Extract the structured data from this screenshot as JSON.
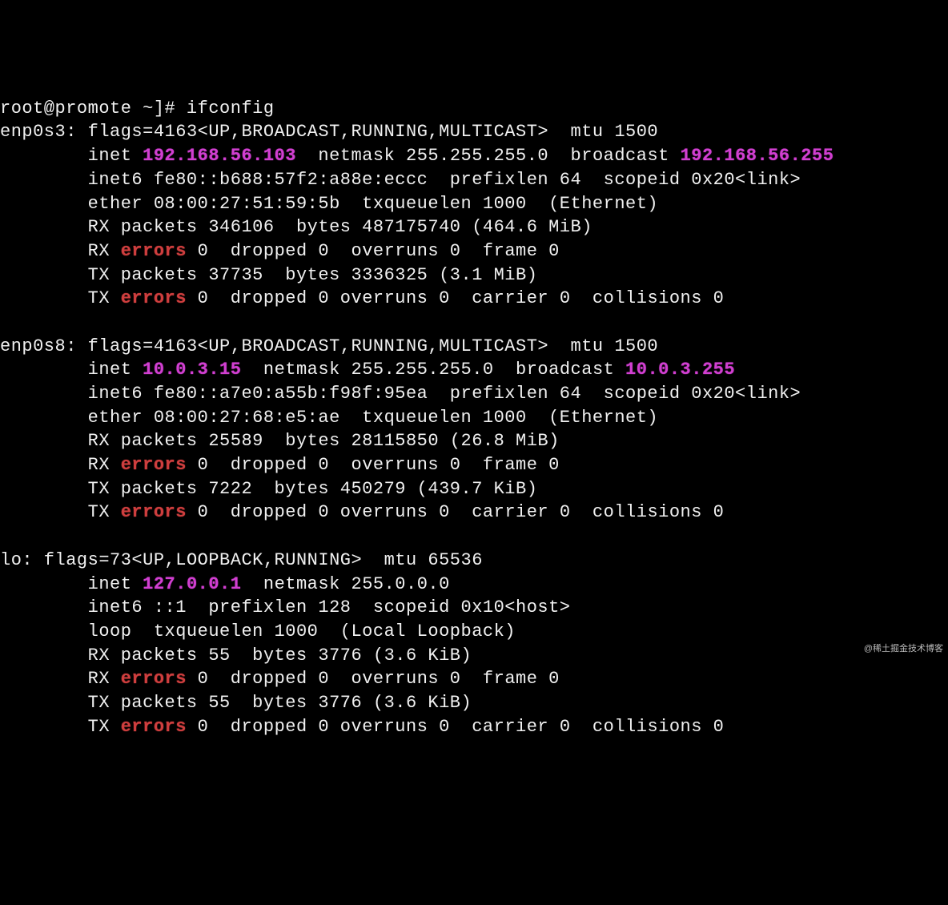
{
  "prompt": "root@promote ~]# ifconfig",
  "interfaces": {
    "enp0s3": {
      "name": "enp0s3:",
      "flags_line": " flags=4163<UP,BROADCAST,RUNNING,MULTICAST>  mtu 1500",
      "inet_prefix": "        inet ",
      "inet_addr": "192.168.56.103",
      "inet_rest": "  netmask 255.255.255.0  broadcast ",
      "broadcast": "192.168.56.255",
      "inet6": "        inet6 fe80::b688:57f2:a88e:eccc  prefixlen 64  scopeid 0x20<link>",
      "ether": "        ether 08:00:27:51:59:5b  txqueuelen 1000  (Ethernet)",
      "rx_pkts": "        RX packets 346106  bytes 487175740 (464.6 MiB)",
      "rx_err_pre": "        RX ",
      "rx_err_word": "errors",
      "rx_err_rest": " 0  dropped 0  overruns 0  frame 0",
      "tx_pkts": "        TX packets 37735  bytes 3336325 (3.1 MiB)",
      "tx_err_pre": "        TX ",
      "tx_err_word": "errors",
      "tx_err_rest": " 0  dropped 0 overruns 0  carrier 0  collisions 0"
    },
    "enp0s8": {
      "name": "enp0s8:",
      "flags_line": " flags=4163<UP,BROADCAST,RUNNING,MULTICAST>  mtu 1500",
      "inet_prefix": "        inet ",
      "inet_addr": "10.0.3.15",
      "inet_rest": "  netmask 255.255.255.0  broadcast ",
      "broadcast": "10.0.3.255",
      "inet6": "        inet6 fe80::a7e0:a55b:f98f:95ea  prefixlen 64  scopeid 0x20<link>",
      "ether": "        ether 08:00:27:68:e5:ae  txqueuelen 1000  (Ethernet)",
      "rx_pkts": "        RX packets 25589  bytes 28115850 (26.8 MiB)",
      "rx_err_pre": "        RX ",
      "rx_err_word": "errors",
      "rx_err_rest": " 0  dropped 0  overruns 0  frame 0",
      "tx_pkts": "        TX packets 7222  bytes 450279 (439.7 KiB)",
      "tx_err_pre": "        TX ",
      "tx_err_word": "errors",
      "tx_err_rest": " 0  dropped 0 overruns 0  carrier 0  collisions 0"
    },
    "lo": {
      "name": "lo:",
      "flags_line": " flags=73<UP,LOOPBACK,RUNNING>  mtu 65536",
      "inet_prefix": "        inet ",
      "inet_addr": "127.0.0.1",
      "inet_rest": "  netmask 255.0.0.0",
      "inet6": "        inet6 ::1  prefixlen 128  scopeid 0x10<host>",
      "ether": "        loop  txqueuelen 1000  (Local Loopback)",
      "rx_pkts": "        RX packets 55  bytes 3776 (3.6 KiB)",
      "rx_err_pre": "        RX ",
      "rx_err_word": "errors",
      "rx_err_rest": " 0  dropped 0  overruns 0  frame 0",
      "tx_pkts": "        TX packets 55  bytes 3776 (3.6 KiB)",
      "tx_err_pre": "        TX ",
      "tx_err_word": "errors",
      "tx_err_rest": " 0  dropped 0 overruns 0  carrier 0  collisions 0"
    }
  },
  "watermark": "@稀土掘金技术博客"
}
